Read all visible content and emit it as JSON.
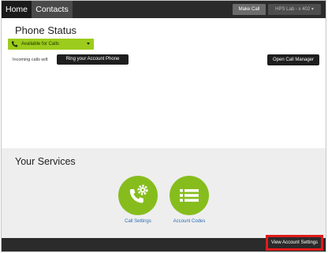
{
  "nav": {
    "tabs": [
      {
        "label": "Home",
        "active": true
      },
      {
        "label": "Contacts",
        "active": false
      }
    ],
    "make_call_label": "Make Call",
    "lab_label": "HPS Lab - x 402 ▾"
  },
  "phone_status": {
    "title": "Phone Status",
    "status_value": "Available for Calls",
    "incoming_label": "Incoming calls will:",
    "ring_label": "Ring your Account Phone",
    "open_call_manager_label": "Open Call Manager"
  },
  "services": {
    "title": "Your Services",
    "items": [
      {
        "label": "Call Settings",
        "icon": "phone-gear-icon"
      },
      {
        "label": "Account Codes",
        "icon": "list-icon"
      }
    ]
  },
  "footer": {
    "view_account_settings_label": "View Account Settings"
  },
  "colors": {
    "accent_green": "#86bd1d",
    "status_green": "#9ccc1c",
    "link_blue": "#2a6fb5",
    "highlight_red": "#e01b1b",
    "bar_dark": "#2b2b2b"
  }
}
